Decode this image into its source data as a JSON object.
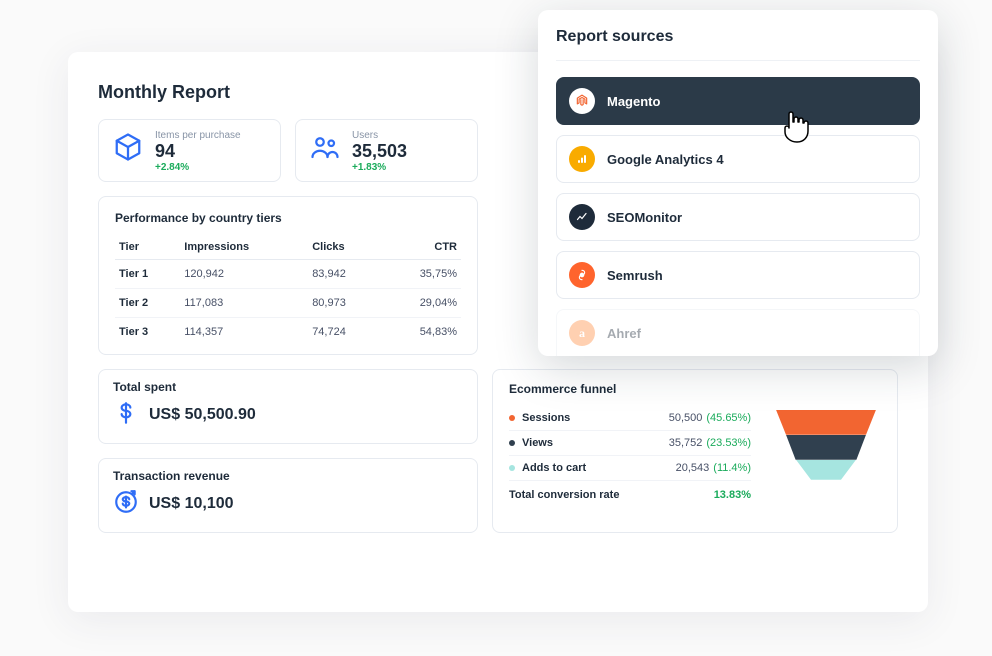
{
  "dashboard": {
    "title": "Monthly Report",
    "kpis": {
      "items": {
        "label": "Items per purchase",
        "value": "94",
        "delta": "+2.84%"
      },
      "users": {
        "label": "Users",
        "value": "35,503",
        "delta": "+1.83%"
      }
    },
    "performance": {
      "title": "Performance by country tiers",
      "columns": [
        "Tier",
        "Impressions",
        "Clicks",
        "CTR"
      ],
      "rows": [
        {
          "tier": "Tier 1",
          "impressions": "120,942",
          "clicks": "83,942",
          "ctr": "35,75%"
        },
        {
          "tier": "Tier 2",
          "impressions": "117,083",
          "clicks": "80,973",
          "ctr": "29,04%"
        },
        {
          "tier": "Tier 3",
          "impressions": "114,357",
          "clicks": "74,724",
          "ctr": "54,83%"
        }
      ]
    },
    "totalSpent": {
      "title": "Total spent",
      "value": "US$ 50,500.90"
    },
    "transactionRevenue": {
      "title": "Transaction revenue",
      "value": "US$ 10,100"
    },
    "funnel": {
      "title": "Ecommerce funnel",
      "levels": [
        {
          "name": "Sessions",
          "value": "50,500",
          "pct": "(45.65%)",
          "color": "#f26531"
        },
        {
          "name": "Views",
          "value": "35,752",
          "pct": "(23.53%)",
          "color": "#30404f"
        },
        {
          "name": "Adds to cart",
          "value": "20,543",
          "pct": "(11.4%)",
          "color": "#a6e5e0"
        }
      ],
      "totalLabel": "Total conversion rate",
      "totalPct": "13.83%"
    }
  },
  "sources": {
    "title": "Report sources",
    "items": [
      {
        "label": "Magento",
        "icon": "magento",
        "active": true
      },
      {
        "label": "Google Analytics 4",
        "icon": "ga"
      },
      {
        "label": "SEOMonitor",
        "icon": "seo"
      },
      {
        "label": "Semrush",
        "icon": "sem"
      },
      {
        "label": "Ahref",
        "icon": "ahref",
        "dim": true
      }
    ]
  },
  "chart_data": {
    "type": "funnel",
    "title": "Ecommerce funnel",
    "categories": [
      "Sessions",
      "Views",
      "Adds to cart"
    ],
    "values": [
      50500,
      35752,
      20543
    ],
    "percentages": [
      45.65,
      23.53,
      11.4
    ],
    "colors": [
      "#f26531",
      "#30404f",
      "#a6e5e0"
    ],
    "total_conversion_rate": 13.83
  }
}
